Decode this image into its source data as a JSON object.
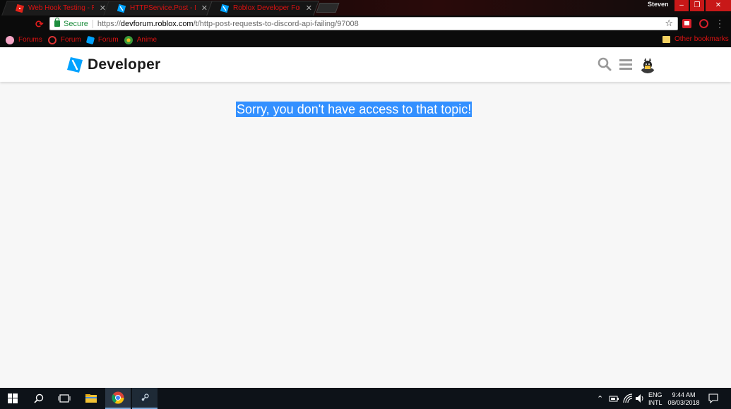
{
  "browser": {
    "tabs": [
      {
        "title": "Web Hook Testing - Rob",
        "favicon": "roblox-favicon",
        "active": false
      },
      {
        "title": "HTTPService.Post - Dev",
        "favicon": "roblox-favicon",
        "active": false
      },
      {
        "title": "Roblox Developer Forum",
        "favicon": "roblox-developer-favicon",
        "active": true
      }
    ],
    "profile_name": "Steven",
    "window_controls": {
      "minimize": "–",
      "restore": "❐",
      "close": "✕"
    },
    "address": {
      "security_label": "Secure",
      "protocol": "https://",
      "host": "devforum.roblox.com",
      "path": "/t/http-post-requests-to-discord-api-failing/97008"
    },
    "bookmarks": [
      {
        "label": "Forums",
        "icon": "pink-circle-icon"
      },
      {
        "label": "Forum",
        "icon": "target-icon"
      },
      {
        "label": "Forum",
        "icon": "roblox-icon"
      },
      {
        "label": "Anime",
        "icon": "anime-icon"
      }
    ],
    "other_bookmarks_label": "Other bookmarks",
    "accent_color": "#d11111"
  },
  "site": {
    "logo_text": "Developer",
    "brand_color": "#00a2ff",
    "header_icons": [
      "search-icon",
      "hamburger-menu-icon",
      "user-avatar"
    ],
    "message": "Sorry, you don't have access to that topic!",
    "selection_color": "#3390ff"
  },
  "taskbar": {
    "pinned": [
      "windows-start-icon",
      "search-icon",
      "task-view-icon",
      "file-explorer-icon",
      "chrome-icon",
      "steam-icon"
    ],
    "language_line1": "ENG",
    "language_line2": "INTL",
    "time": "9:44 AM",
    "date": "08/03/2018"
  }
}
